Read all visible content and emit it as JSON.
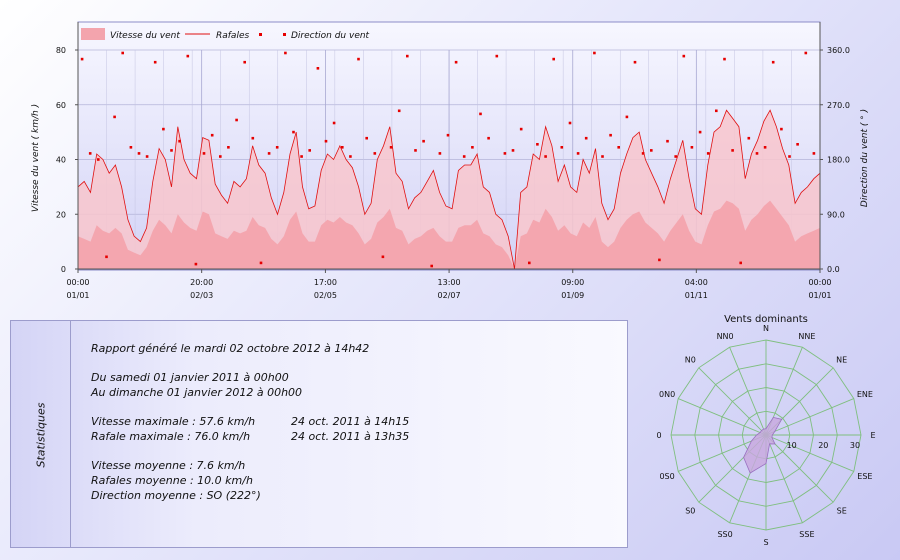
{
  "colors": {
    "speed_fill": "#f3a4ad",
    "gust_line": "#e01010",
    "direction_point": "#e60000",
    "rose_grid": "#7fbf7f",
    "rose_fill": "#c8a8de",
    "plot_bg_top": "#f7f7ff",
    "plot_bg_bottom": "#d3d3f6"
  },
  "chart_data": [
    {
      "type": "area",
      "legend": {
        "placement": "top-left",
        "entries": [
          "Vitesse du vent",
          "Rafales",
          "Direction du vent"
        ]
      },
      "ylabel": "Vitesse du vent ( km/h )",
      "ylabel2": "Direction du vent ( ° )",
      "ylim": [
        0,
        80
      ],
      "ylim2": [
        0,
        360
      ],
      "yticks": [
        "0",
        "20",
        "40",
        "60",
        "80"
      ],
      "yticks2": [
        "0.0",
        "90.0",
        "180.0",
        "270.0",
        "360.0"
      ],
      "xlim": [
        "2011-01-01 00:00",
        "2012-01-01 00:00"
      ],
      "xticks": [
        {
          "time": "00:00",
          "date": "01/01",
          "x": "2011-01-01 00:00"
        },
        {
          "time": "20:00",
          "date": "02/03",
          "x": "2011-03-02 20:00"
        },
        {
          "time": "17:00",
          "date": "02/05",
          "x": "2011-05-02 17:00"
        },
        {
          "time": "13:00",
          "date": "02/07",
          "x": "2011-07-02 13:00"
        },
        {
          "time": "09:00",
          "date": "01/09",
          "x": "2011-09-01 09:00"
        },
        {
          "time": "04:00",
          "date": "01/11",
          "x": "2011-11-01 04:00"
        },
        {
          "time": "00:00",
          "date": "01/01",
          "x": "2012-01-01 00:00"
        }
      ],
      "grid": true,
      "series": [
        {
          "name": "Vitesse du vent",
          "values": [
            12,
            11,
            10,
            16,
            14,
            13,
            15,
            13,
            7,
            6,
            5,
            8,
            14,
            18,
            16,
            13,
            20,
            17,
            15,
            14,
            21,
            20,
            13,
            12,
            11,
            14,
            13,
            14,
            19,
            16,
            15,
            11,
            9,
            12,
            18,
            21,
            13,
            10,
            10,
            16,
            18,
            17,
            19,
            17,
            16,
            13,
            9,
            11,
            17,
            19,
            22,
            15,
            14,
            9,
            11,
            12,
            14,
            15,
            12,
            10,
            10,
            15,
            16,
            16,
            18,
            13,
            12,
            9,
            8,
            5,
            0,
            12,
            13,
            18,
            17,
            22,
            19,
            14,
            16,
            13,
            12,
            17,
            15,
            19,
            10,
            8,
            10,
            15,
            18,
            20,
            21,
            17,
            15,
            13,
            10,
            14,
            17,
            20,
            14,
            10,
            9,
            16,
            21,
            22,
            25,
            24,
            22,
            14,
            18,
            20,
            23,
            25,
            22,
            19,
            16,
            10,
            12,
            13,
            14,
            15
          ]
        },
        {
          "name": "Rafales",
          "values": [
            30,
            32,
            28,
            42,
            40,
            35,
            38,
            30,
            18,
            12,
            10,
            15,
            32,
            44,
            40,
            30,
            52,
            40,
            35,
            33,
            48,
            47,
            31,
            27,
            24,
            32,
            30,
            33,
            45,
            38,
            35,
            26,
            20,
            28,
            42,
            50,
            30,
            22,
            23,
            36,
            42,
            40,
            45,
            40,
            37,
            30,
            20,
            24,
            40,
            45,
            52,
            35,
            32,
            22,
            26,
            28,
            32,
            36,
            28,
            23,
            22,
            36,
            38,
            38,
            42,
            30,
            28,
            20,
            18,
            12,
            0,
            28,
            30,
            42,
            40,
            52,
            45,
            32,
            38,
            30,
            28,
            40,
            35,
            44,
            24,
            18,
            22,
            35,
            42,
            48,
            50,
            40,
            35,
            30,
            24,
            33,
            40,
            47,
            33,
            22,
            20,
            38,
            50,
            52,
            58,
            55,
            52,
            33,
            42,
            47,
            54,
            58,
            52,
            44,
            38,
            24,
            28,
            30,
            33,
            35
          ]
        },
        {
          "name": "Direction du vent",
          "x": [
            "2011-01-03",
            "2011-01-07",
            "2011-01-11",
            "2011-01-15",
            "2011-01-19",
            "2011-01-23",
            "2011-01-27",
            "2011-01-31",
            "2011-02-04",
            "2011-02-08",
            "2011-02-12",
            "2011-02-16",
            "2011-02-20",
            "2011-02-24",
            "2011-02-28",
            "2011-03-04",
            "2011-03-08",
            "2011-03-12",
            "2011-03-16",
            "2011-03-20",
            "2011-03-24",
            "2011-03-28",
            "2011-04-01",
            "2011-04-05",
            "2011-04-09",
            "2011-04-13",
            "2011-04-17",
            "2011-04-21",
            "2011-04-25",
            "2011-04-29",
            "2011-05-03",
            "2011-05-07",
            "2011-05-11",
            "2011-05-15",
            "2011-05-19",
            "2011-05-23",
            "2011-05-27",
            "2011-05-31",
            "2011-06-04",
            "2011-06-08",
            "2011-06-12",
            "2011-06-16",
            "2011-06-20",
            "2011-06-24",
            "2011-06-28",
            "2011-07-02",
            "2011-07-06",
            "2011-07-10",
            "2011-07-14",
            "2011-07-18",
            "2011-07-22",
            "2011-07-26",
            "2011-07-30",
            "2011-08-03",
            "2011-08-07",
            "2011-08-11",
            "2011-08-15",
            "2011-08-19",
            "2011-08-23",
            "2011-08-27",
            "2011-08-31",
            "2011-09-04",
            "2011-09-08",
            "2011-09-12",
            "2011-09-16",
            "2011-09-20",
            "2011-09-24",
            "2011-09-28",
            "2011-10-02",
            "2011-10-06",
            "2011-10-10",
            "2011-10-14",
            "2011-10-18",
            "2011-10-22",
            "2011-10-26",
            "2011-10-30",
            "2011-11-03",
            "2011-11-07",
            "2011-11-11",
            "2011-11-15",
            "2011-11-19",
            "2011-11-23",
            "2011-11-27",
            "2011-12-01",
            "2011-12-05",
            "2011-12-09",
            "2011-12-13",
            "2011-12-17",
            "2011-12-21",
            "2011-12-25",
            "2011-12-29"
          ],
          "values": [
            345,
            190,
            180,
            20,
            250,
            355,
            200,
            190,
            185,
            340,
            230,
            195,
            210,
            350,
            8,
            190,
            220,
            185,
            200,
            245,
            340,
            215,
            10,
            190,
            200,
            355,
            225,
            185,
            195,
            330,
            210,
            240,
            200,
            185,
            345,
            215,
            190,
            20,
            200,
            260,
            350,
            195,
            210,
            5,
            190,
            220,
            340,
            185,
            200,
            255,
            215,
            350,
            190,
            195,
            230,
            10,
            205,
            185,
            345,
            200,
            240,
            190,
            215,
            355,
            185,
            220,
            200,
            250,
            340,
            190,
            195,
            15,
            210,
            185,
            350,
            200,
            225,
            190,
            260,
            345,
            195,
            10,
            215,
            190,
            200,
            340,
            230,
            185,
            205,
            355,
            190
          ]
        }
      ]
    },
    {
      "type": "radar",
      "title": "Vents dominants",
      "categories": [
        "N",
        "NNE",
        "NE",
        "ENE",
        "E",
        "ESE",
        "SE",
        "SSE",
        "S",
        "SS0",
        "S0",
        "0S0",
        "0",
        "0N0",
        "N0",
        "NN0"
      ],
      "rlim": [
        0,
        30
      ],
      "rticks": [
        "10",
        "20",
        "30"
      ],
      "series": [
        {
          "values": [
            2,
            6,
            7,
            3,
            2,
            2,
            4,
            3,
            9,
            13,
            10,
            5,
            3,
            2,
            2,
            2
          ]
        }
      ]
    }
  ],
  "report": {
    "side_label": "Statistiques",
    "generated": "Rapport généré le mardi 02 octobre 2012 à 14h42",
    "period_from": "Du samedi 01 janvier 2011 à 00h00",
    "period_to": "Au dimanche 01 janvier 2012 à 00h00",
    "max_speed_label": "Vitesse maximale : 57.6 km/h",
    "max_speed_date": "24 oct. 2011 à 14h15",
    "max_gust_label": "Rafale maximale : 76.0 km/h",
    "max_gust_date": "24 oct. 2011 à 13h35",
    "avg_speed": "Vitesse moyenne : 7.6 km/h",
    "avg_gust": "Rafales moyenne : 10.0 km/h",
    "avg_direction": "Direction moyenne : SO (222°)"
  }
}
